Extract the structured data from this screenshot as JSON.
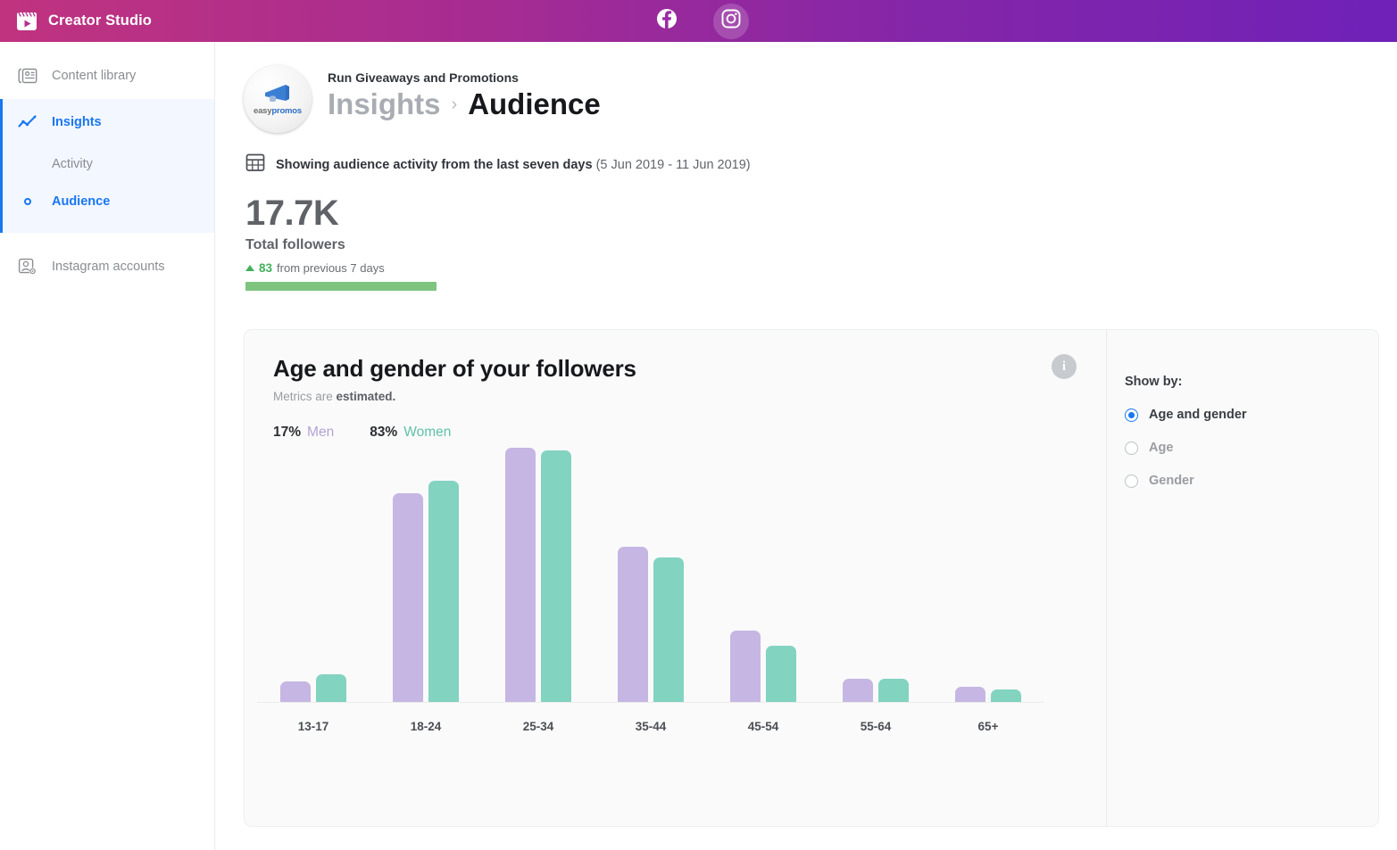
{
  "topbar": {
    "brand": "Creator Studio",
    "brand_icon": "clapperboard-icon",
    "social": [
      {
        "name": "facebook-icon",
        "label": "Facebook",
        "active": false
      },
      {
        "name": "instagram-icon",
        "label": "Instagram",
        "active": true
      }
    ]
  },
  "sidebar": {
    "items": [
      {
        "label": "Content library",
        "icon": "content-library-icon",
        "state": "default"
      },
      {
        "label": "Insights",
        "icon": "insights-chart-icon",
        "state": "active"
      },
      {
        "label": "Activity",
        "icon": "none",
        "state": "sub"
      },
      {
        "label": "Audience",
        "icon": "circle-dot-icon",
        "state": "sub-selected"
      },
      {
        "label": "Instagram accounts",
        "icon": "account-settings-icon",
        "state": "default"
      }
    ]
  },
  "header": {
    "avatar_text_light": "easy",
    "avatar_text_bold": "promos",
    "account_name": "Run Giveaways and Promotions",
    "breadcrumb_parent": "Insights",
    "breadcrumb_separator": "›",
    "breadcrumb_current": "Audience"
  },
  "daterow": {
    "icon": "calendar-icon",
    "text": "Showing audience activity from the last seven days",
    "range": "(5 Jun 2019 - 11 Jun 2019)"
  },
  "stat": {
    "value": "17.7K",
    "label": "Total followers",
    "delta_value": "83",
    "delta_text": "from previous 7 days",
    "delta_color": "#42b05c"
  },
  "card": {
    "title": "Age and gender of your followers",
    "subtitle_prefix": "Metrics are ",
    "subtitle_emphasis": "estimated.",
    "info_icon_glyph": "i",
    "legend": [
      {
        "pct": "17%",
        "name": "Men",
        "color": "#b3a3d2"
      },
      {
        "pct": "83%",
        "name": "Women",
        "color": "#5fc2a7"
      }
    ]
  },
  "showby": {
    "title": "Show by:",
    "options": [
      {
        "label": "Age and gender",
        "selected": true
      },
      {
        "label": "Age",
        "selected": false
      },
      {
        "label": "Gender",
        "selected": false
      }
    ]
  },
  "chart_data": {
    "type": "bar",
    "title": "Age and gender of your followers",
    "xlabel": "",
    "ylabel": "",
    "categories": [
      "13-17",
      "18-24",
      "25-34",
      "35-44",
      "45-54",
      "55-64",
      "65+"
    ],
    "series": [
      {
        "name": "Men",
        "color": "#c6b6e3",
        "values": [
          8,
          82,
          100,
          61,
          28,
          9,
          6
        ]
      },
      {
        "name": "Women",
        "color": "#82d3c0",
        "values": [
          11,
          87,
          99,
          57,
          22,
          9,
          5
        ]
      }
    ],
    "ylim": [
      0,
      100
    ],
    "grid": false,
    "legend_position": "top-left",
    "annotations": [
      "Metrics are estimated."
    ]
  }
}
